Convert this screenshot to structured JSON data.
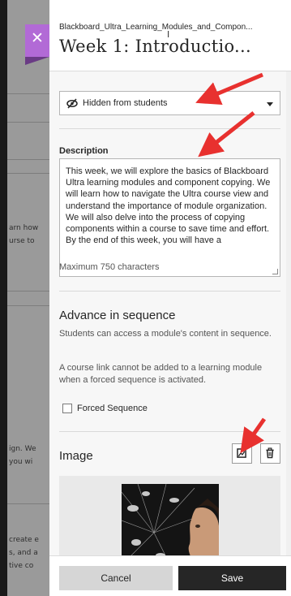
{
  "background": {
    "snippets": [
      "arn how",
      "urse to",
      "ign. We",
      "you wi",
      "create e",
      "s, and a",
      "tive co"
    ]
  },
  "header": {
    "breadcrumb": "Blackboard_Ultra_Learning_Modules_and_Compon...",
    "title": "Week 1: Introductio..."
  },
  "visibility": {
    "icon": "eye-slash-icon",
    "label": "Hidden from students"
  },
  "description": {
    "label": "Description",
    "text": "This week, we will explore the basics of Blackboard Ultra learning modules and component copying. We will learn how to navigate the Ultra course view and understand the importance of module organization. We will also delve into the process of copying components within a course to save time and effort. By the end of this week, you will have a",
    "limit_note": "Maximum 750 characters"
  },
  "sequence": {
    "title": "Advance in sequence",
    "description": "Students can access a module's content in sequence.",
    "note": "A course link cannot be added to a learning module when a forced sequence is activated.",
    "checkbox_label": "Forced Sequence",
    "checked": false
  },
  "image": {
    "label": "Image"
  },
  "footer": {
    "cancel_label": "Cancel",
    "save_label": "Save"
  },
  "colors": {
    "accent": "#b26ad6",
    "arrow": "#e8312f",
    "primary_button": "#262626"
  }
}
